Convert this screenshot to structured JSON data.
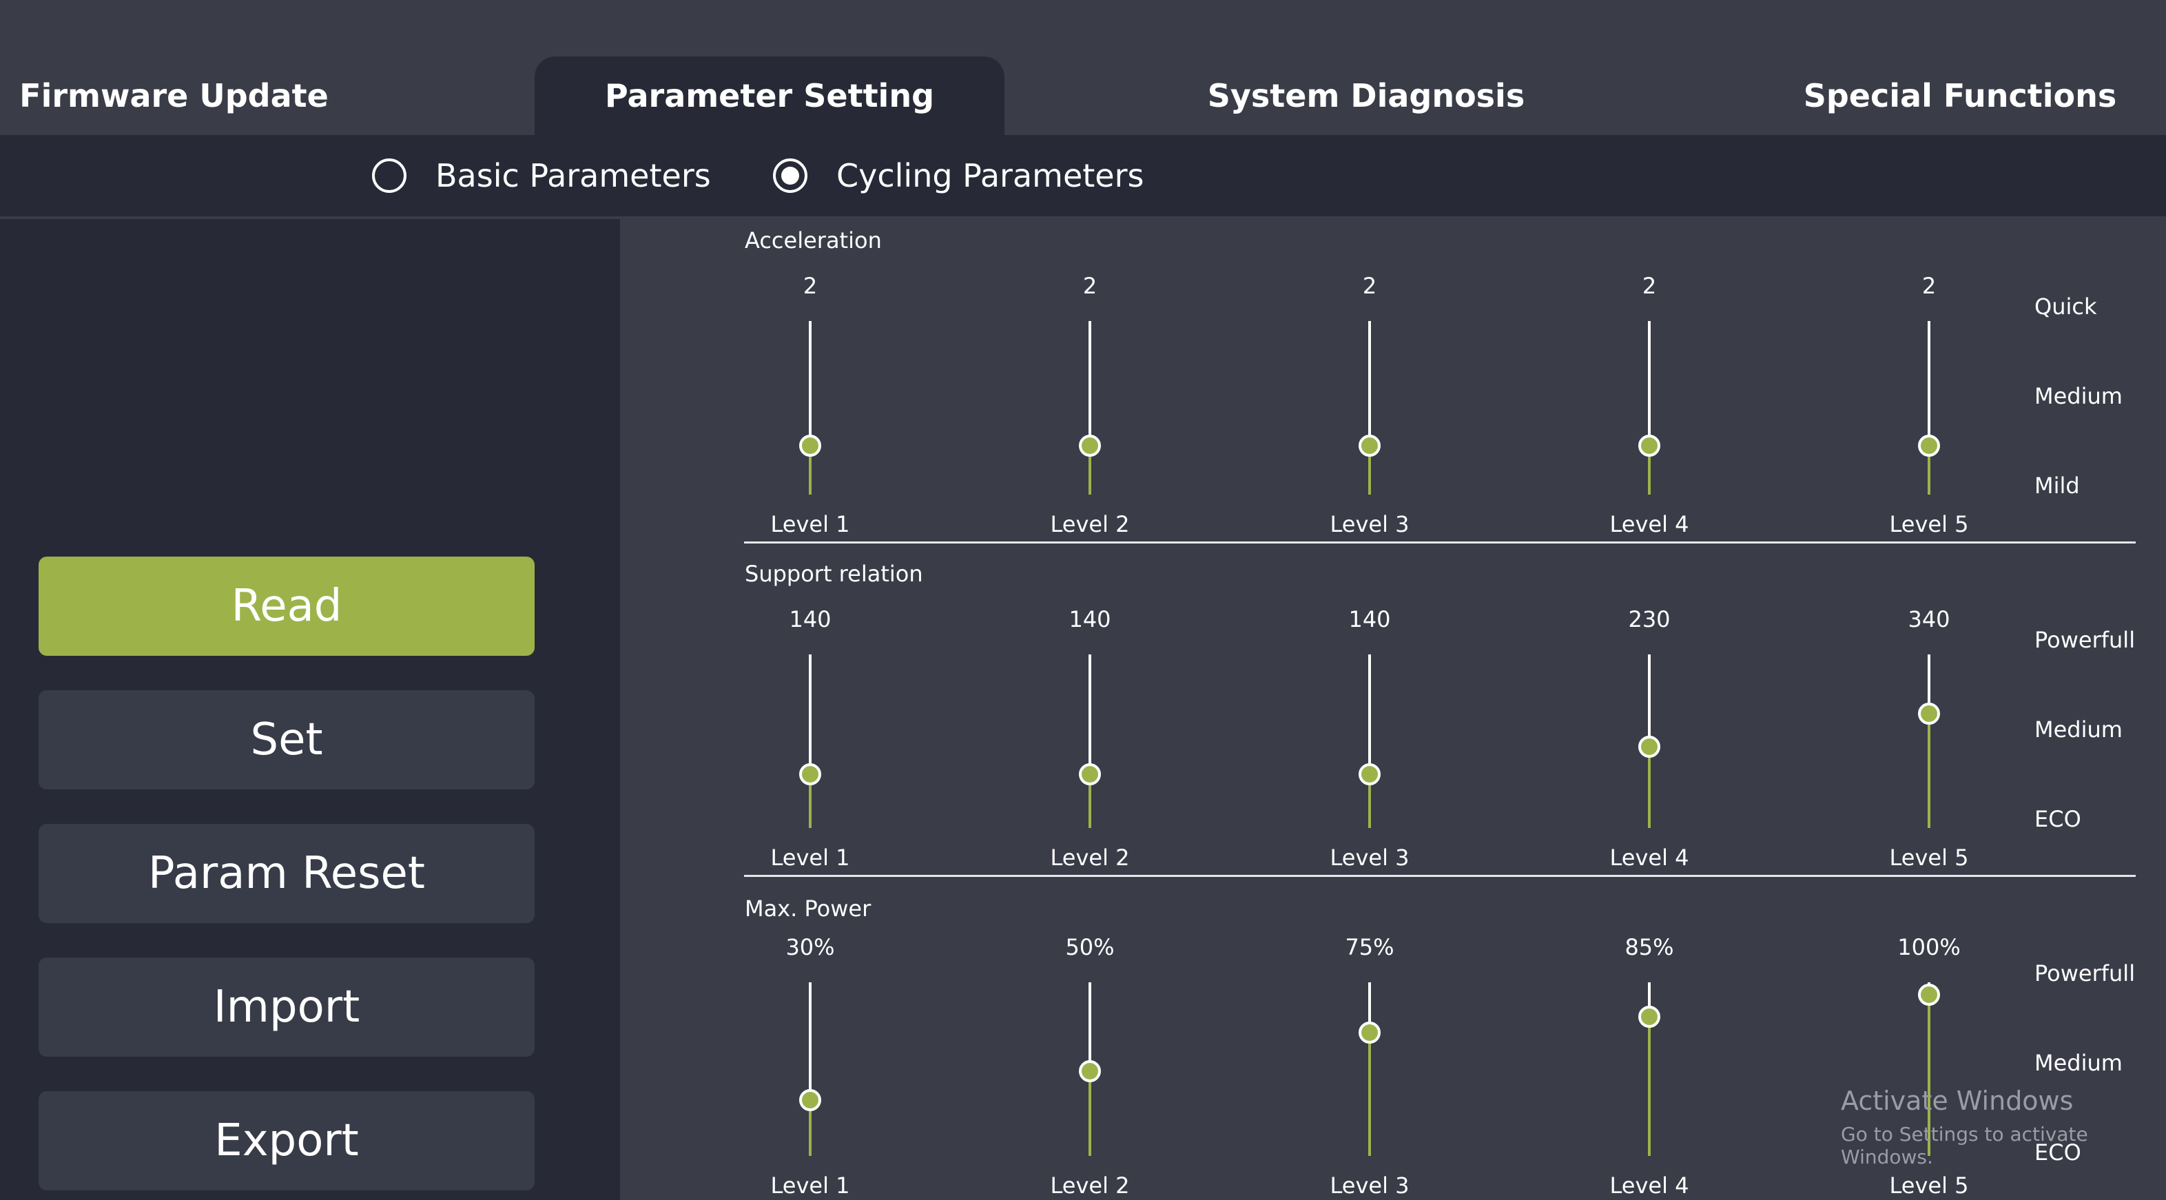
{
  "tabs": [
    {
      "label": "Firmware Update",
      "active": false
    },
    {
      "label": "Parameter Setting",
      "active": true
    },
    {
      "label": "System Diagnosis",
      "active": false
    },
    {
      "label": "Special Functions",
      "active": false
    }
  ],
  "mode_options": {
    "basic": {
      "label": "Basic Parameters",
      "selected": false
    },
    "cycling": {
      "label": "Cycling Parameters",
      "selected": true
    }
  },
  "actions": {
    "read": "Read",
    "set": "Set",
    "param_reset": "Param Reset",
    "import": "Import",
    "export": "Export"
  },
  "colors": {
    "accent": "#9db34a",
    "background": "#3a3c48",
    "panel": "#272a36",
    "button": "#383b48"
  },
  "sections": [
    {
      "title": "Acceleration",
      "scale": [
        "Quick",
        "Medium",
        "Mild"
      ],
      "sliders": [
        {
          "label": "Level 1",
          "value": "2",
          "level_fraction": 0.28
        },
        {
          "label": "Level 2",
          "value": "2",
          "level_fraction": 0.28
        },
        {
          "label": "Level 3",
          "value": "2",
          "level_fraction": 0.28
        },
        {
          "label": "Level 4",
          "value": "2",
          "level_fraction": 0.28
        },
        {
          "label": "Level 5",
          "value": "2",
          "level_fraction": 0.28
        }
      ]
    },
    {
      "title": "Support relation",
      "scale": [
        "Powerfull",
        "Medium",
        "ECO"
      ],
      "sliders": [
        {
          "label": "Level 1",
          "value": "140",
          "level_fraction": 0.31
        },
        {
          "label": "Level 2",
          "value": "140",
          "level_fraction": 0.31
        },
        {
          "label": "Level 3",
          "value": "140",
          "level_fraction": 0.31
        },
        {
          "label": "Level 4",
          "value": "230",
          "level_fraction": 0.47
        },
        {
          "label": "Level 5",
          "value": "340",
          "level_fraction": 0.66
        }
      ]
    },
    {
      "title": "Max. Power",
      "scale": [
        "Powerfull",
        "Medium",
        "ECO"
      ],
      "sliders": [
        {
          "label": "Level 1",
          "value": "30%",
          "level_fraction": 0.32
        },
        {
          "label": "Level 2",
          "value": "50%",
          "level_fraction": 0.49
        },
        {
          "label": "Level 3",
          "value": "75%",
          "level_fraction": 0.71
        },
        {
          "label": "Level 4",
          "value": "85%",
          "level_fraction": 0.8
        },
        {
          "label": "Level 5",
          "value": "100%",
          "level_fraction": 0.93
        }
      ]
    }
  ],
  "watermark": {
    "title": "Activate Windows",
    "subtitle": "Go to Settings to activate Windows."
  }
}
